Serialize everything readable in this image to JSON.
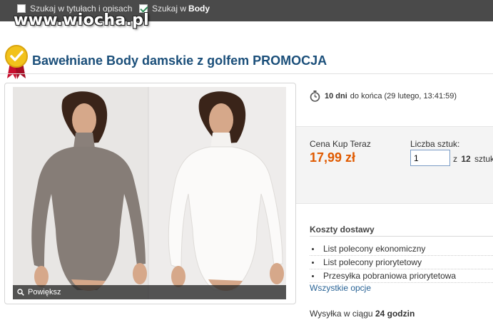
{
  "filters": {
    "desc_label": "Szukaj w tytułach i opisach",
    "body_prefix": "Szukaj w",
    "body_value": "Body"
  },
  "watermark": "www.wiocha.pl",
  "title": "Bawełniane Body damskie z golfem PROMOCJA",
  "gallery": {
    "zoom_label": "Powiększ"
  },
  "timer": {
    "days": "10 dni",
    "rest": "do końca (29 lutego, 13:41:59)"
  },
  "buy": {
    "price_label": "Cena Kup Teraz",
    "price": "17,99 zł",
    "qty_label": "Liczba sztuk:",
    "qty_value": "1",
    "qty_of": "z",
    "qty_total": "12",
    "qty_unit": "sztuk"
  },
  "shipping": {
    "title": "Koszty dostawy",
    "options": [
      "List polecony ekonomiczny",
      "List polecony priorytetowy",
      "Przesyłka pobraniowa priorytetowa"
    ],
    "all_options": "Wszystkie opcje",
    "dispatch_prefix": "Wysyłka w ciągu",
    "dispatch_value": "24 godzin"
  },
  "colors": {
    "title": "#1b4f7a",
    "price": "#e05a00",
    "link": "#2a6496",
    "topbar": "#4a4a4a"
  }
}
